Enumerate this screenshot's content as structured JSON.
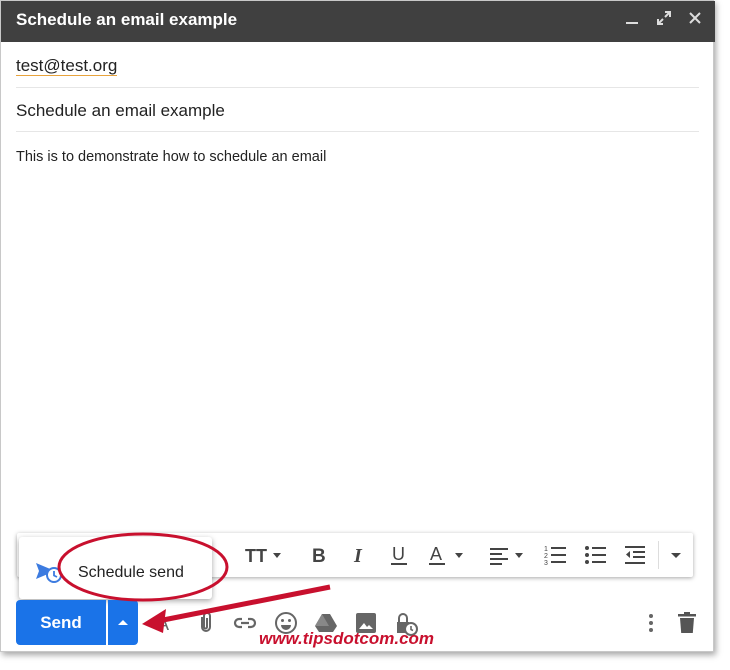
{
  "window": {
    "title": "Schedule an email example",
    "controls": [
      "minimize-icon",
      "expand-icon",
      "close-icon"
    ]
  },
  "compose": {
    "to": "test@test.org",
    "subject": "Schedule an email example",
    "body": "This is to demonstrate how to schedule an email"
  },
  "formatting_toolbar": {
    "icons": [
      "text-size-icon",
      "bold-icon",
      "italic-icon",
      "underline-icon",
      "text-color-icon",
      "align-icon",
      "numbered-list-icon",
      "bulleted-list-icon",
      "indent-less-icon",
      "more-formatting-icon"
    ]
  },
  "schedule_menu": {
    "item_label": "Schedule send",
    "item_icon": "schedule-send-icon"
  },
  "bottom_toolbar": {
    "send_label": "Send",
    "more_send_options_icon": "caret-up-icon",
    "icons": [
      "formatting-icon",
      "attach-icon",
      "link-icon",
      "emoji-icon",
      "drive-icon",
      "photo-icon",
      "confidential-icon",
      "more-options-icon",
      "delete-icon"
    ]
  },
  "annotation": {
    "watermark": "www.tipsdotcom.com",
    "accent_color": "#c8102e"
  },
  "colors": {
    "titlebar": "#404040",
    "send_button": "#1a73e8"
  }
}
